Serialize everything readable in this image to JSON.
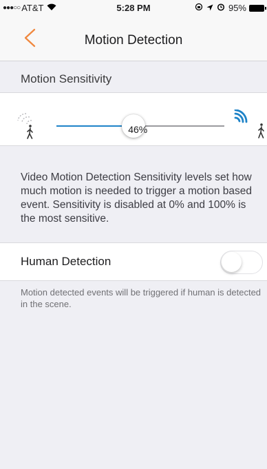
{
  "status_bar": {
    "signal": "●●●○○",
    "carrier": "AT&T",
    "time": "5:28 PM",
    "battery_percent": "95%",
    "icons": [
      "wifi-icon",
      "rotation-lock-icon",
      "location-icon",
      "alarm-icon",
      "battery-icon"
    ]
  },
  "nav": {
    "back_icon": "chevron-left-icon",
    "title": "Motion Detection"
  },
  "sensitivity": {
    "header": "Motion Sensitivity",
    "value": 0.46,
    "value_label": "46%",
    "low_icon": "walking-person-faint-waves-icon",
    "high_icon": "walking-person-strong-waves-icon",
    "description": "Video Motion Detection Sensitivity levels set how much motion is needed to trigger a motion based event. Sensitivity is disabled at 0% and 100% is the most sensitive."
  },
  "human_detection": {
    "label": "Human Detection",
    "enabled": false,
    "note": "Motion detected events will be triggered if human is detected in the scene."
  },
  "colors": {
    "accent": "#f0883e",
    "slider_active": "#1e83c8",
    "background": "#efeff4"
  }
}
